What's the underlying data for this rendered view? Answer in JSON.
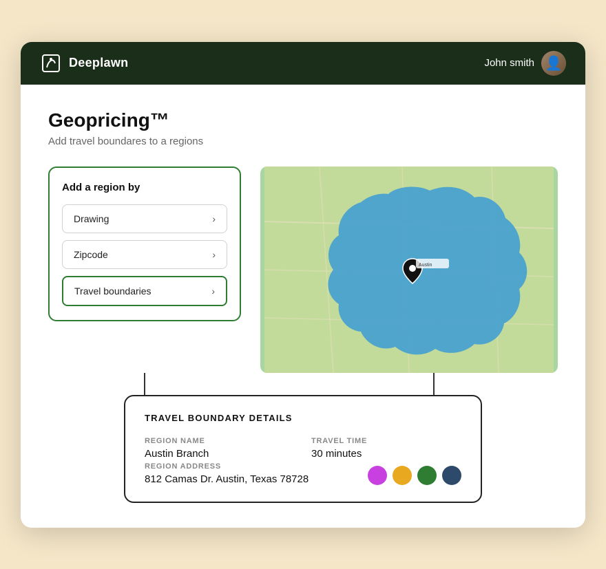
{
  "navbar": {
    "logo_label": "Deeplawn",
    "username": "John smith"
  },
  "page": {
    "title": "Geopricing™",
    "subtitle": "Add travel boundares to a regions"
  },
  "region_card": {
    "title": "Add a region by",
    "options": [
      {
        "id": "drawing",
        "label": "Drawing",
        "active": false
      },
      {
        "id": "zipcode",
        "label": "Zipcode",
        "active": false
      },
      {
        "id": "travel",
        "label": "Travel boundaries",
        "active": true
      }
    ]
  },
  "details_card": {
    "title": "TRAVEL BOUNDARY DETAILS",
    "region_name_label": "REGION NAME",
    "region_name_value": "Austin Branch",
    "travel_time_label": "TRAVEL TIME",
    "travel_time_value": "30 minutes",
    "region_address_label": "REGION ADDRESS",
    "region_address_value": "812 Camas Dr. Austin, Texas 78728",
    "colors": [
      "#c840e0",
      "#e8a820",
      "#2e7d32",
      "#2d4a6a"
    ]
  }
}
